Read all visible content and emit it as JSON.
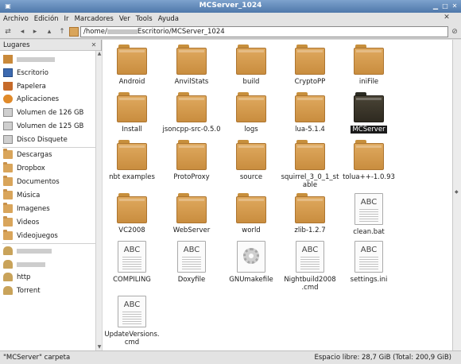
{
  "window": {
    "title": "MCServer_1024"
  },
  "menubar": {
    "items": [
      "Archivo",
      "Edición",
      "Ir",
      "Marcadores",
      "Ver",
      "Tools",
      "Ayuda"
    ]
  },
  "toolbar": {
    "location_prefix": "/home/",
    "location_suffix": "Escritorio/MCServer_1024"
  },
  "sidebar": {
    "header": "Lugares",
    "items": [
      {
        "label": "",
        "icon": "home-folder-icon"
      },
      {
        "label": "Escritorio",
        "icon": "desktop-icon"
      },
      {
        "label": "Papelera",
        "icon": "trash-icon"
      },
      {
        "label": "Aplicaciones",
        "icon": "applications-icon"
      },
      {
        "label": "Volumen de 126 GB",
        "icon": "drive-icon"
      },
      {
        "label": "Volumen de 125 GB",
        "icon": "drive-icon"
      },
      {
        "label": "Disco Disquete",
        "icon": "floppy-icon"
      },
      {
        "label": "Descargas",
        "icon": "folder-icon"
      },
      {
        "label": "Dropbox",
        "icon": "folder-icon"
      },
      {
        "label": "Documentos",
        "icon": "folder-icon"
      },
      {
        "label": "Música",
        "icon": "folder-icon"
      },
      {
        "label": "Imagenes",
        "icon": "folder-icon"
      },
      {
        "label": "Videos",
        "icon": "folder-icon"
      },
      {
        "label": "Videojuegos",
        "icon": "folder-icon"
      },
      {
        "label": "",
        "icon": "network-icon"
      },
      {
        "label": "",
        "icon": "network-icon"
      },
      {
        "label": "http",
        "icon": "network-icon"
      },
      {
        "label": "Torrent",
        "icon": "network-icon"
      }
    ]
  },
  "files": [
    {
      "name": "Android",
      "type": "folder"
    },
    {
      "name": "AnvilStats",
      "type": "folder"
    },
    {
      "name": "build",
      "type": "folder"
    },
    {
      "name": "CryptoPP",
      "type": "folder"
    },
    {
      "name": "iniFile",
      "type": "folder"
    },
    {
      "name": "Install",
      "type": "folder"
    },
    {
      "name": "jsoncpp-src-0.5.0",
      "type": "folder"
    },
    {
      "name": "logs",
      "type": "folder"
    },
    {
      "name": "lua-5.1.4",
      "type": "folder"
    },
    {
      "name": "MCServer",
      "type": "folder",
      "selected": true
    },
    {
      "name": "nbt examples",
      "type": "folder"
    },
    {
      "name": "ProtoProxy",
      "type": "folder"
    },
    {
      "name": "source",
      "type": "folder"
    },
    {
      "name": "squirrel_3_0_1_stable",
      "type": "folder"
    },
    {
      "name": "tolua++-1.0.93",
      "type": "folder"
    },
    {
      "name": "VC2008",
      "type": "folder"
    },
    {
      "name": "WebServer",
      "type": "folder"
    },
    {
      "name": "world",
      "type": "folder"
    },
    {
      "name": "zlib-1.2.7",
      "type": "folder"
    },
    {
      "name": "clean.bat",
      "type": "text",
      "icon_text": "ABC"
    },
    {
      "name": "COMPILING",
      "type": "text",
      "icon_text": "ABC"
    },
    {
      "name": "Doxyfile",
      "type": "text",
      "icon_text": "ABC"
    },
    {
      "name": "GNUmakefile",
      "type": "makefile"
    },
    {
      "name": "Nightbuild2008.cmd",
      "type": "text",
      "icon_text": "ABC"
    },
    {
      "name": "settings.ini",
      "type": "text",
      "icon_text": "ABC"
    },
    {
      "name": "UpdateVersions.cmd",
      "type": "text",
      "icon_text": "ABC"
    }
  ],
  "statusbar": {
    "left": "\"MCServer\" carpeta",
    "right": "Espacio libre: 28,7 GiB (Total: 200,9 GiB)"
  }
}
